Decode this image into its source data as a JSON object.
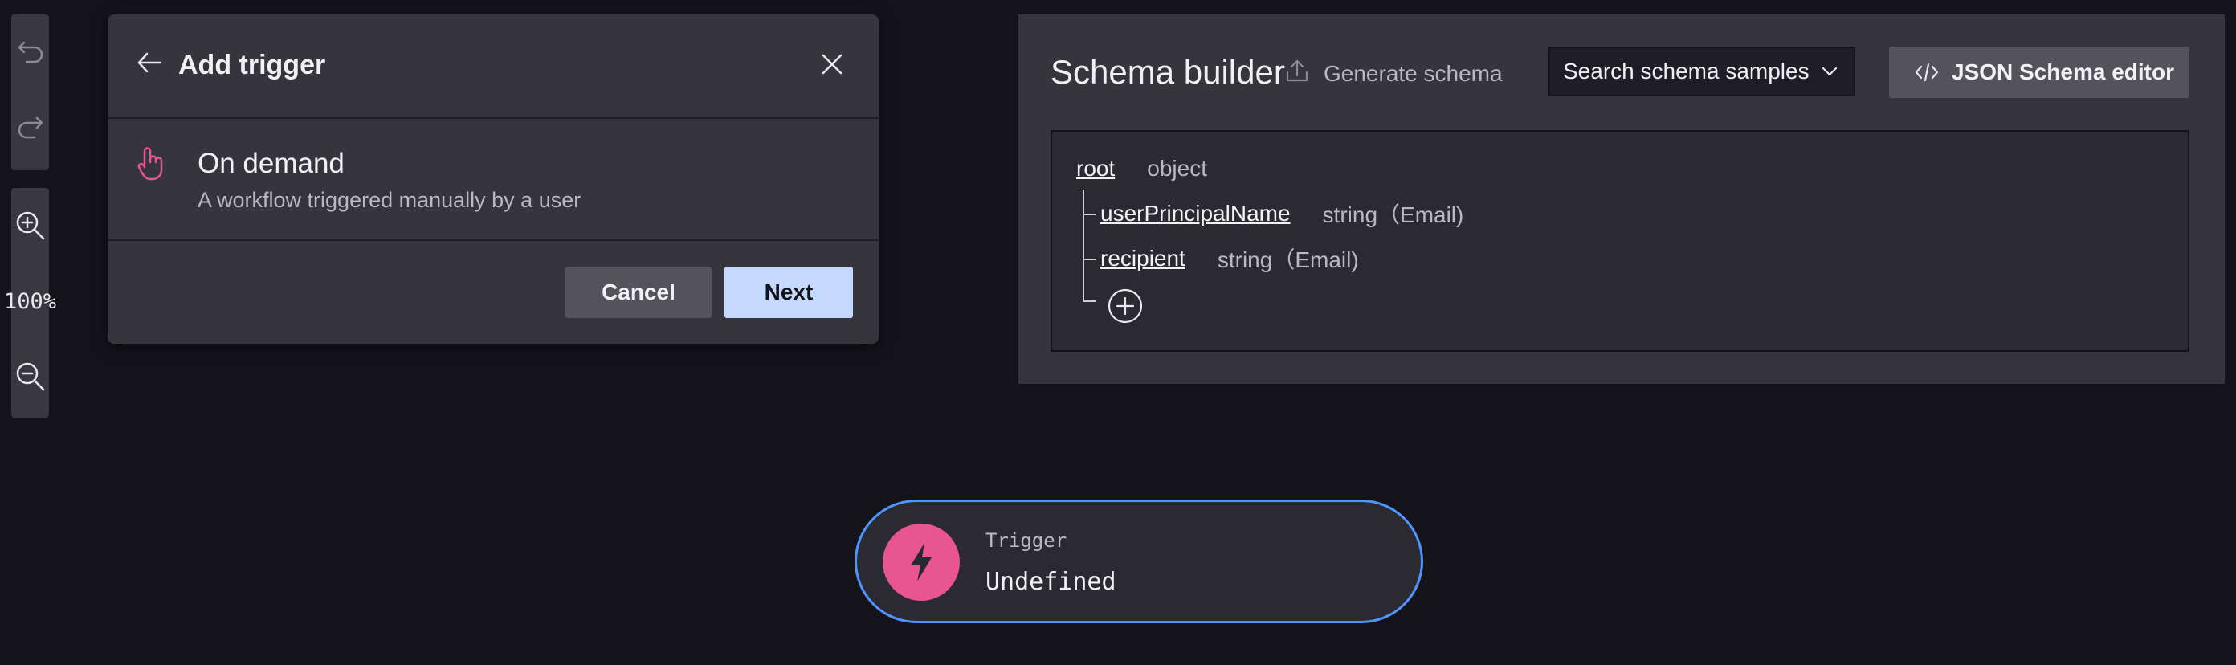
{
  "toolbar": {
    "undo_icon": "undo-icon",
    "redo_icon": "redo-icon",
    "zoom_in_icon": "zoom-in-icon",
    "zoom_level": "100%",
    "zoom_out_icon": "zoom-out-icon"
  },
  "dialog": {
    "title": "Add trigger",
    "back_icon": "arrow-left-icon",
    "close_icon": "close-icon",
    "option": {
      "icon": "hand-pointer-icon",
      "icon_color": "#e8558f",
      "title": "On demand",
      "description": "A workflow triggered manually by a user"
    },
    "cancel_label": "Cancel",
    "next_label": "Next"
  },
  "schema_builder": {
    "title": "Schema builder",
    "generate_icon": "upload-icon",
    "generate_label": "Generate schema",
    "samples_placeholder": "Search schema samples",
    "json_editor_icon": "code-icon",
    "json_editor_label": "JSON Schema editor",
    "tree": {
      "root": {
        "name": "root",
        "type": "object"
      },
      "properties": [
        {
          "name": "userPrincipalName",
          "type": "string（Email)"
        },
        {
          "name": "recipient",
          "type": "string（Email)"
        }
      ],
      "add_icon": "plus-circle-icon"
    }
  },
  "trigger_node": {
    "label": "Trigger",
    "value": "Undefined",
    "icon": "lightning-icon",
    "icon_color": "#e8558f",
    "border_color": "#4d95ff"
  }
}
